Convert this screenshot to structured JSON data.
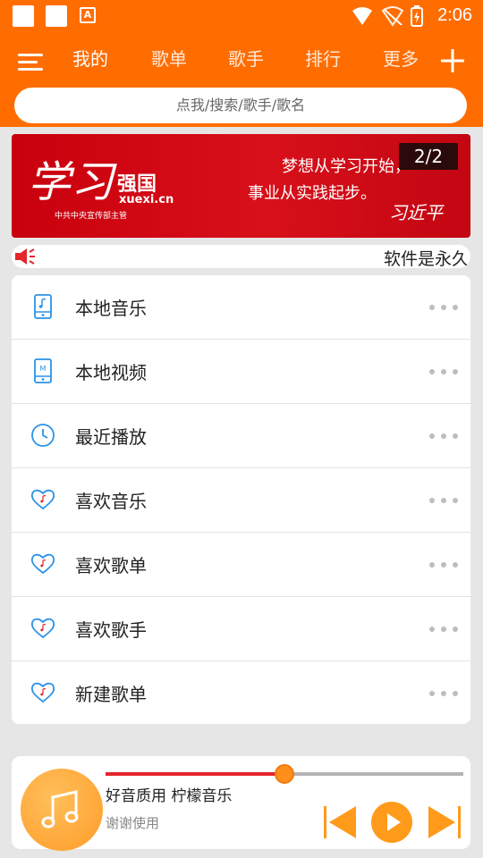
{
  "status_bar": {
    "time": "2:06",
    "app_icon_letter": "A"
  },
  "header": {
    "tabs": [
      {
        "label": "我的",
        "active": true
      },
      {
        "label": "歌单",
        "active": false
      },
      {
        "label": "歌手",
        "active": false
      },
      {
        "label": "排行",
        "active": false
      },
      {
        "label": "更多",
        "active": false
      }
    ],
    "search_placeholder": "点我/搜索/歌手/歌名"
  },
  "banner": {
    "logo_text": "学习",
    "brand": "强国",
    "url": "xuexi.cn",
    "subtitle": "中共中央宣传部主管",
    "line1": "梦想从学习开始，",
    "line2": "事业从实践起步。",
    "signature": "习近平",
    "counter": "2/2"
  },
  "notice": {
    "text": "软件是永久"
  },
  "menu": [
    {
      "label": "本地音乐",
      "icon": "music-phone-icon"
    },
    {
      "label": "本地视频",
      "icon": "video-phone-icon"
    },
    {
      "label": "最近播放",
      "icon": "clock-icon"
    },
    {
      "label": "喜欢音乐",
      "icon": "heart-note-icon"
    },
    {
      "label": "喜欢歌单",
      "icon": "heart-note-icon"
    },
    {
      "label": "喜欢歌手",
      "icon": "heart-note-icon"
    },
    {
      "label": "新建歌单",
      "icon": "heart-note-icon"
    }
  ],
  "player": {
    "title": "好音质用 柠檬音乐",
    "subtitle": "谢谢使用",
    "progress": 0.5
  },
  "colors": {
    "accent": "#ff6d00",
    "icon_blue": "#2a93e8",
    "progress_red": "#e4252a",
    "control_orange": "#ff9a1a"
  }
}
